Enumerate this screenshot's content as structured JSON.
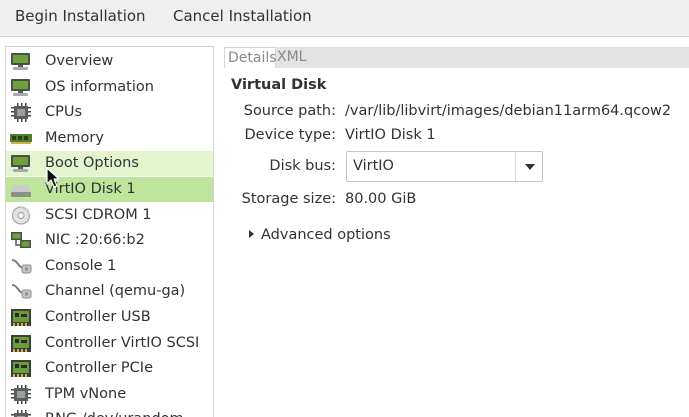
{
  "toolbar": {
    "begin_label": "Begin Installation",
    "cancel_label": "Cancel Installation"
  },
  "sidebar": {
    "items": [
      {
        "label": "Overview",
        "icon": "monitor-icon"
      },
      {
        "label": "OS information",
        "icon": "monitor-icon"
      },
      {
        "label": "CPUs",
        "icon": "cpu-icon"
      },
      {
        "label": "Memory",
        "icon": "memory-icon"
      },
      {
        "label": "Boot Options",
        "icon": "monitor-icon",
        "state": "hover"
      },
      {
        "label": "VirtIO Disk 1",
        "icon": "disk-icon",
        "state": "selected"
      },
      {
        "label": "SCSI CDROM 1",
        "icon": "cdrom-icon"
      },
      {
        "label": "NIC :20:66:b2",
        "icon": "network-icon"
      },
      {
        "label": "Console 1",
        "icon": "serial-icon"
      },
      {
        "label": "Channel (qemu-ga)",
        "icon": "serial-icon"
      },
      {
        "label": "Controller USB",
        "icon": "controller-icon"
      },
      {
        "label": "Controller VirtIO SCSI",
        "icon": "controller-icon"
      },
      {
        "label": "Controller PCIe",
        "icon": "controller-icon"
      },
      {
        "label": "TPM vNone",
        "icon": "cpu-icon"
      },
      {
        "label": "RNG /dev/urandom",
        "icon": "cpu-icon"
      }
    ]
  },
  "tabs": {
    "details": "Details",
    "xml": "XML",
    "active": "Details"
  },
  "disk": {
    "section_title": "Virtual Disk",
    "source_label": "Source path:",
    "source_value": "/var/lib/libvirt/images/debian11arm64.qcow2",
    "type_label": "Device type:",
    "type_value": "VirtIO Disk 1",
    "bus_label": "Disk bus:",
    "bus_value": "VirtIO",
    "size_label": "Storage size:",
    "size_value": "80.00 GiB",
    "advanced_label": "Advanced options"
  },
  "colors": {
    "selected_row": "#bfe59d",
    "hover_row": "#e4f4cf",
    "toolbar_bg": "#efefef"
  }
}
